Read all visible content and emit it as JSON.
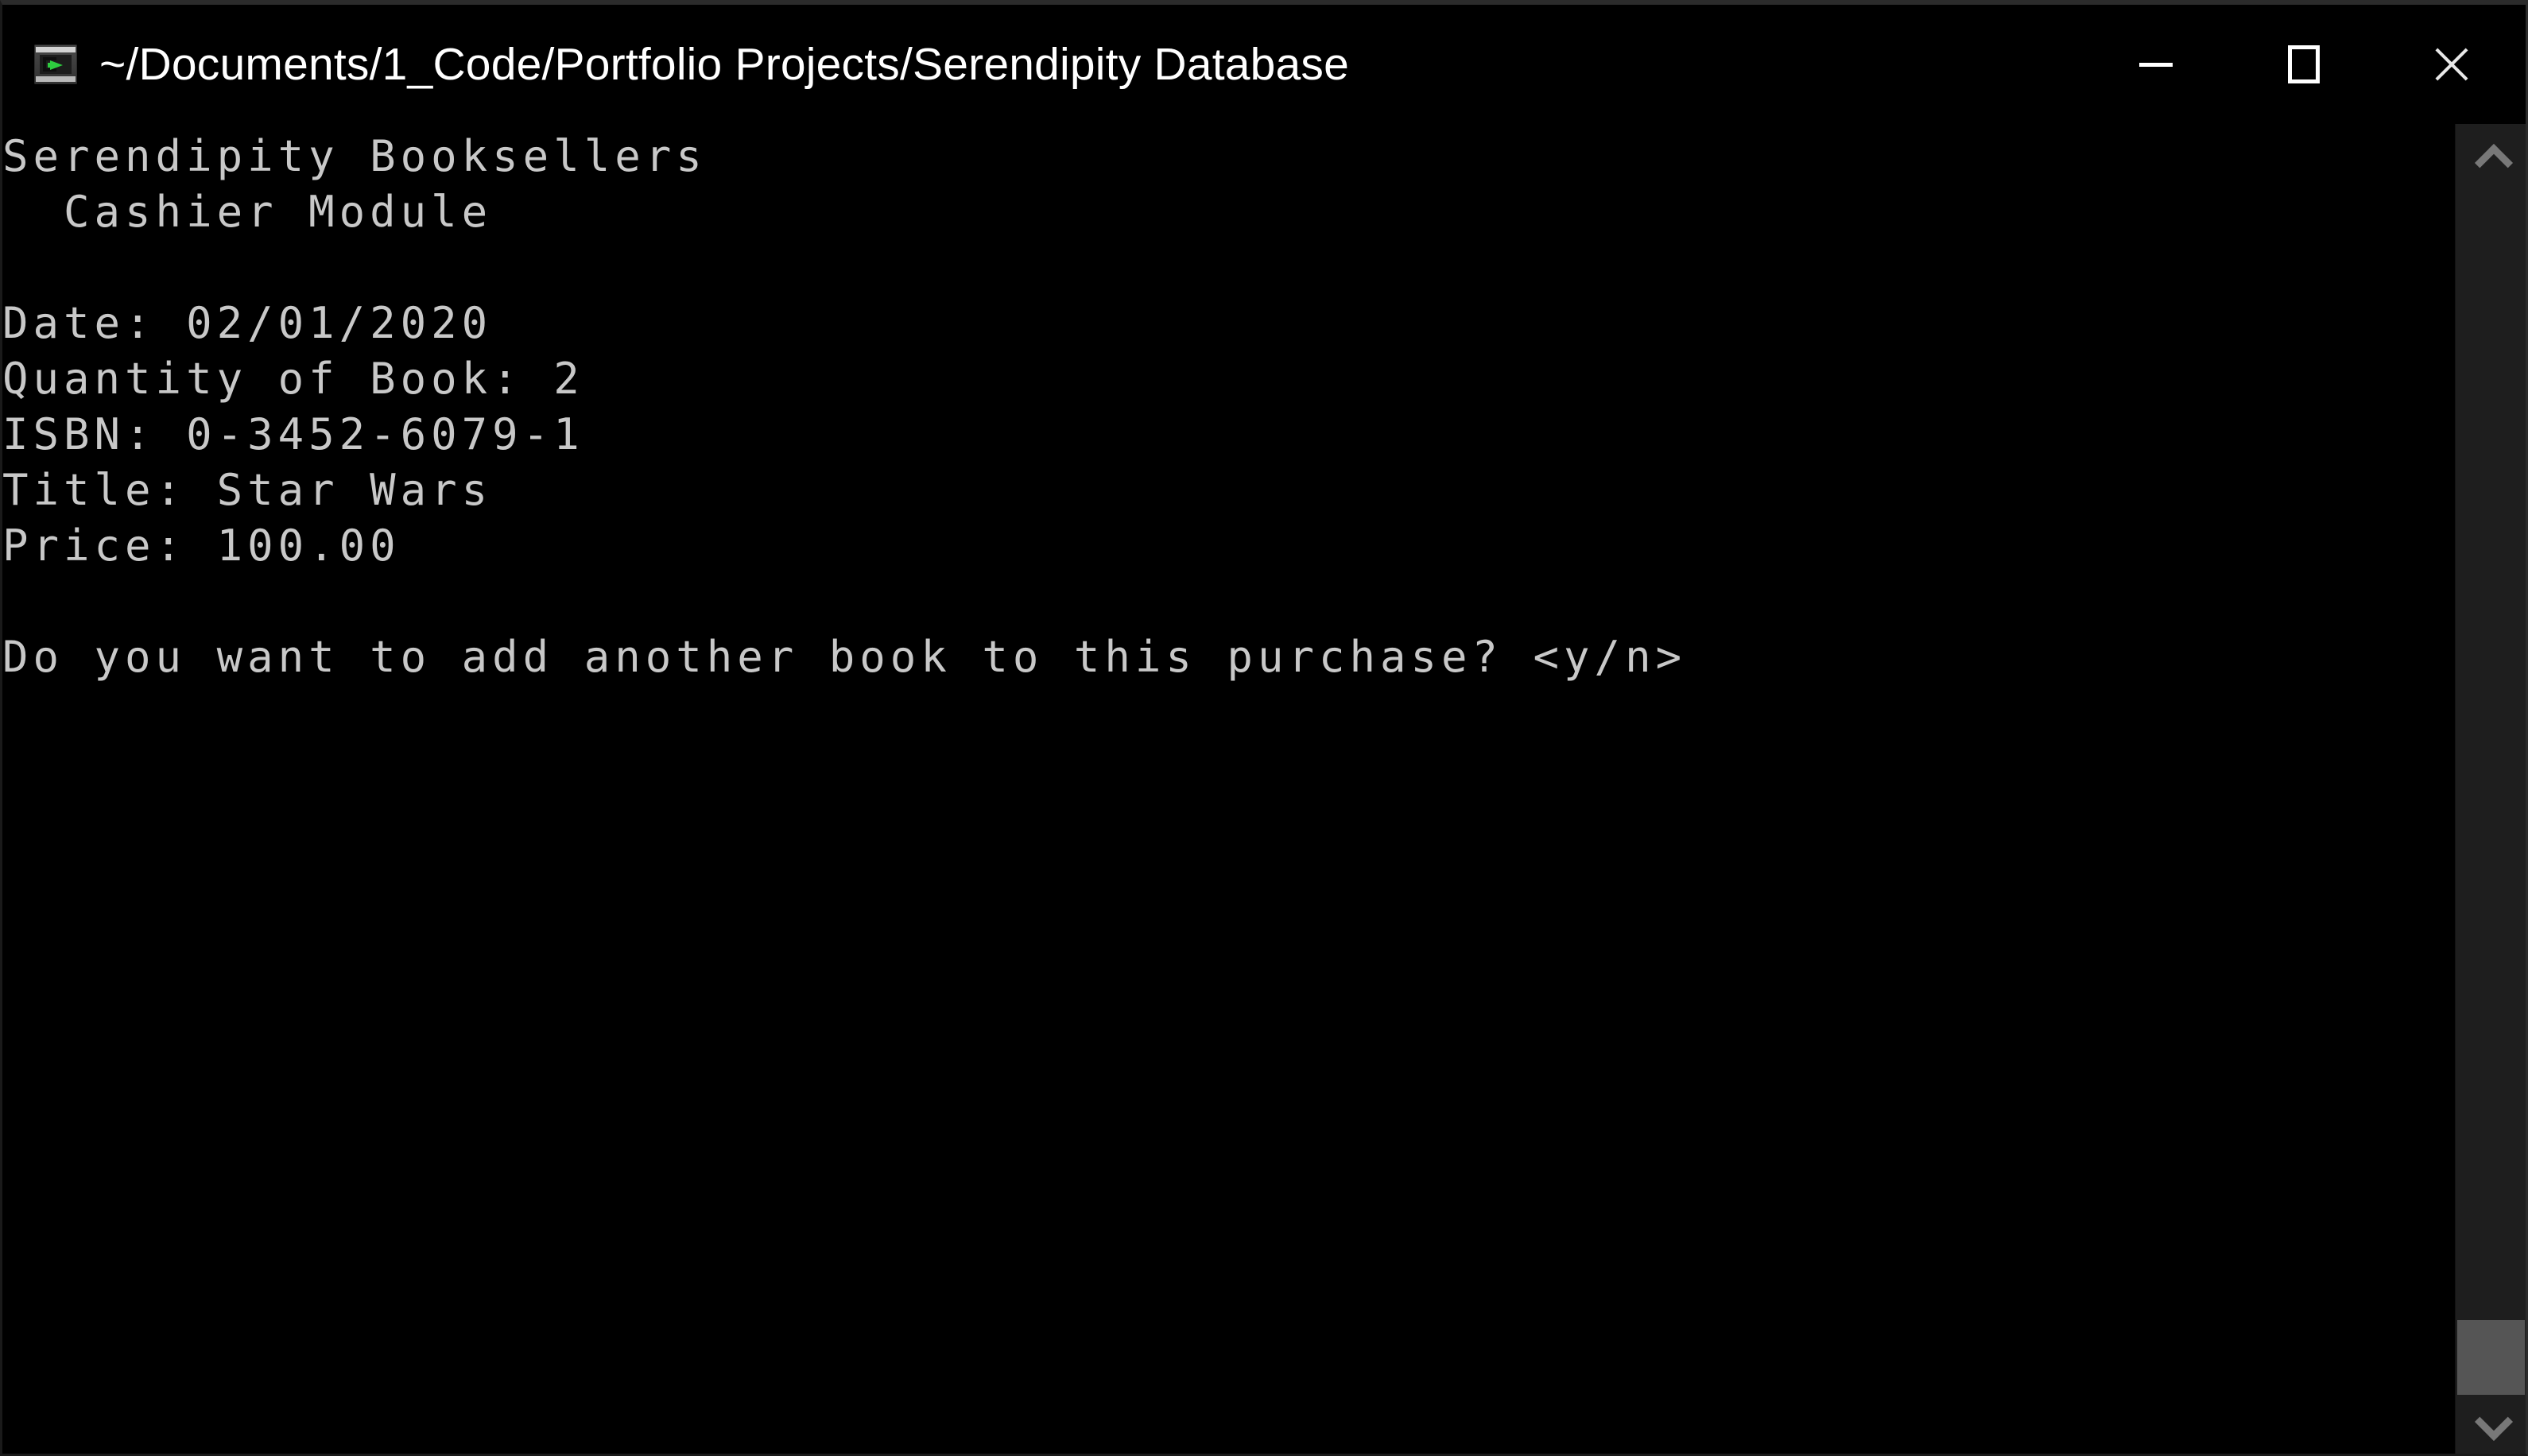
{
  "window": {
    "title": "~/Documents/1_Code/Portfolio Projects/Serendipity Database",
    "icon": "console-window-icon",
    "background_color": "#000000",
    "titlebar_text_color": "#ffffff",
    "controls": {
      "minimize_label": "—",
      "maximize_label": "☐",
      "close_label": "✕"
    }
  },
  "console": {
    "text_color": "#c8c8c8",
    "background_color": "#000000",
    "lines": [
      "Serendipity Booksellers",
      "  Cashier Module",
      "",
      "Date: 02/01/2020",
      "Quantity of Book: 2",
      "ISBN: 0-3452-6079-1",
      "Title: Star Wars",
      "Price: 100.00",
      "",
      "Do you want to add another book to this purchase? <y/n>"
    ],
    "content": "Serendipity Booksellers\n  Cashier Module\n\nDate: 02/01/2020\nQuantity of Book: 2\nISBN: 0-3452-6079-1\nTitle: Star Wars\nPrice: 100.00\n\nDo you want to add another book to this purchase? <y/n>",
    "fields": {
      "header_store": "Serendipity Booksellers",
      "header_module": "Cashier Module",
      "date_label": "Date:",
      "date_value": "02/01/2020",
      "quantity_label": "Quantity of Book:",
      "quantity_value": "2",
      "isbn_label": "ISBN:",
      "isbn_value": "0-3452-6079-1",
      "title_label": "Title:",
      "title_value": "Star Wars",
      "price_label": "Price:",
      "price_value": "100.00",
      "prompt": "Do you want to add another book to this purchase? <y/n>"
    }
  },
  "scrollbar": {
    "up_arrow_icon": "chevron-up-icon",
    "down_arrow_icon": "chevron-down-icon",
    "track_color": "#1e1e1e",
    "thumb_color": "#555555"
  }
}
